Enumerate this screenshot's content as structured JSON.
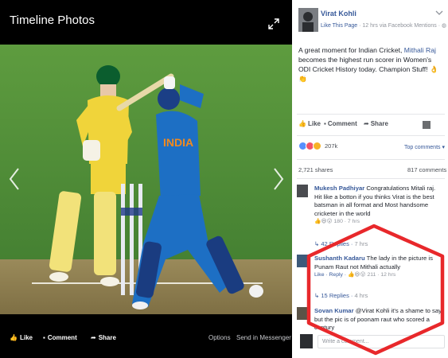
{
  "viewer": {
    "title": "Timeline Photos",
    "actions": {
      "like_label": "Like",
      "comment_label": "Comment",
      "share_label": "Share",
      "options_label": "Options",
      "messenger_label": "Send in Messenger"
    }
  },
  "photo": {
    "jersey_text": "INDIA",
    "icons": [
      "expand-icon",
      "chevron-left-icon",
      "chevron-right-icon"
    ]
  },
  "post": {
    "author": "Virat Kohli",
    "like_page": "Like This Page",
    "meta": "· 12 hrs via Facebook Mentions ·",
    "text_part1": "A great moment for Indian Cricket,",
    "mention": "Mithali Raj",
    "text_part2": "becomes the highest run scorer in Women's ODI Cricket History today. Champion Stuff!",
    "actions": {
      "like_label": "Like",
      "comment_label": "Comment",
      "share_label": "Share"
    },
    "reactions_count": "207k",
    "top_comments_label": "Top comments ▾",
    "shares": "2,721 shares",
    "comments_count": "817 comments"
  },
  "comments": [
    {
      "name": "Mukesh Padhiyar",
      "text": "Congratulations Mitali raj. Hit like a botton if you thinks Virat is the best batsman in all format and Most handsome cricketer in the world",
      "actions": "",
      "likes": "180",
      "time": "7 hrs",
      "replies": "42 Replies",
      "replies_time": "7 hrs"
    },
    {
      "name": "Sushanth Kadaru",
      "text": "The lady in the picture is Punam Raut not Mithali actually",
      "actions": "Like · Reply ·",
      "likes": "211",
      "time": "12 hrs",
      "replies": "15 Replies",
      "replies_time": "4 hrs"
    },
    {
      "name": "Sovan Kumar",
      "text": "@Virat Kohli it's a shame to say but the pic is of poonam raut who scored a century",
      "actions": "",
      "likes": "",
      "time": "",
      "replies": "",
      "replies_time": ""
    }
  ],
  "write_comment": {
    "placeholder": "Write a comment..."
  },
  "colors": {
    "fb_blue": "#365899",
    "annotation_red": "#e8282b",
    "australia_yellow": "#f0d43a",
    "india_blue": "#1d6fc4",
    "grass": "#4f8f3a"
  }
}
